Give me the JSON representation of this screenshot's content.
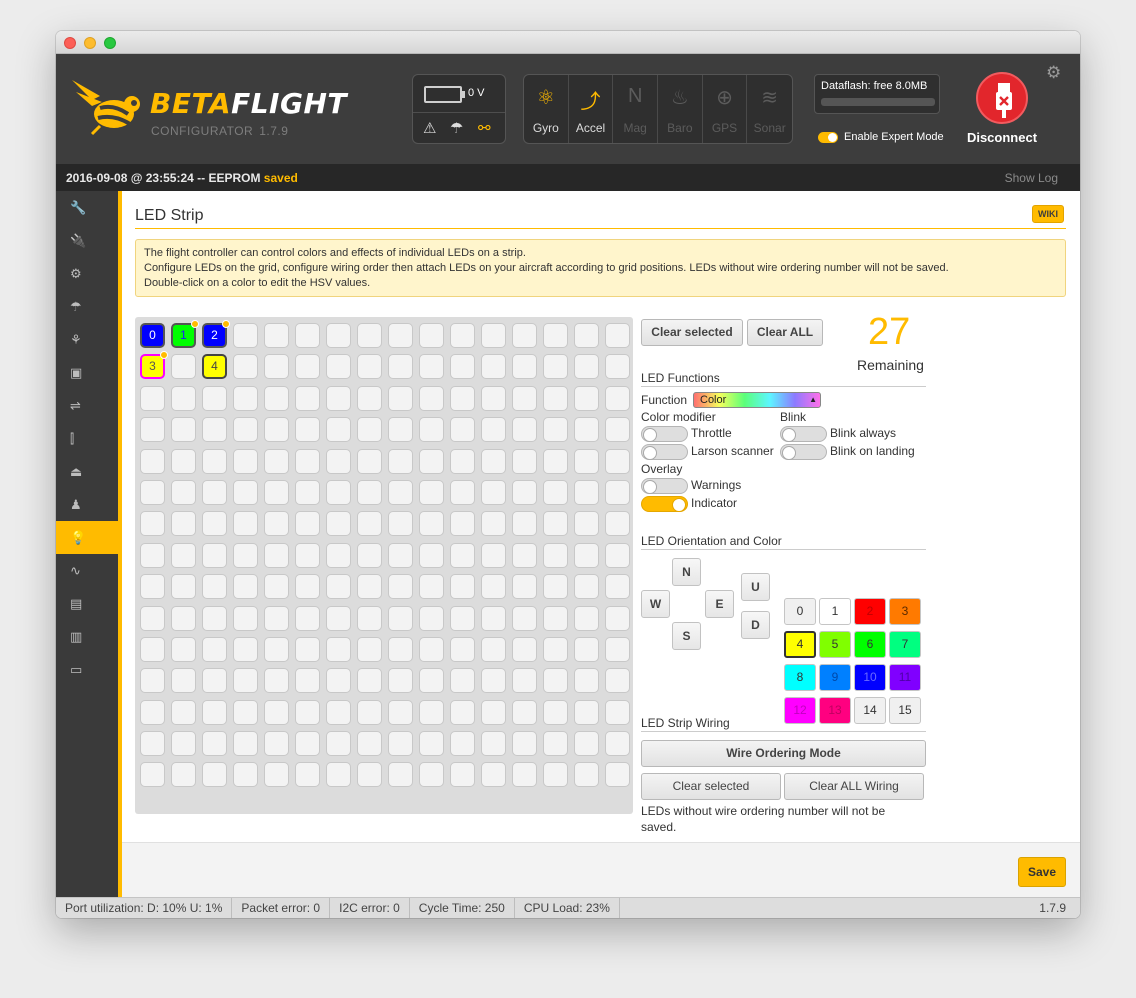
{
  "header": {
    "logo": {
      "title_part1": "BETA",
      "title_part2": "FLIGHT",
      "subtitle": "CONFIGURATOR",
      "version": "1.7.9"
    },
    "battery": {
      "voltage": "0 V"
    },
    "sensors": [
      {
        "label": "Gyro",
        "icon": "gyro-icon",
        "active": true
      },
      {
        "label": "Accel",
        "icon": "accel-icon",
        "active": true
      },
      {
        "label": "Mag",
        "icon": "mag-icon",
        "active": false
      },
      {
        "label": "Baro",
        "icon": "baro-icon",
        "active": false
      },
      {
        "label": "GPS",
        "icon": "gps-icon",
        "active": false
      },
      {
        "label": "Sonar",
        "icon": "sonar-icon",
        "active": false
      }
    ],
    "dataflash": {
      "label": "Dataflash: free 8.0MB"
    },
    "expert_mode": {
      "label": "Enable Expert Mode",
      "enabled": true
    },
    "disconnect": {
      "label": "Disconnect"
    }
  },
  "status": {
    "log_prefix": "2016-09-08 @ 23:55:24 -- EEPROM ",
    "log_saved": "saved",
    "show_log": "Show Log"
  },
  "sidebar": {
    "items": [
      {
        "icon": "wrench-icon",
        "glyph": "🔧"
      },
      {
        "icon": "ports-icon",
        "glyph": "🔌"
      },
      {
        "icon": "gear-icon",
        "glyph": "⚙"
      },
      {
        "icon": "parachute-icon",
        "glyph": "☂"
      },
      {
        "icon": "tree-icon",
        "glyph": "⚘"
      },
      {
        "icon": "receiver-icon",
        "glyph": "▣"
      },
      {
        "icon": "modes-icon",
        "glyph": "⇌"
      },
      {
        "icon": "sliders-icon",
        "glyph": "⫿"
      },
      {
        "icon": "motors-icon",
        "glyph": "⏏"
      },
      {
        "icon": "servos-icon",
        "glyph": "♟"
      },
      {
        "icon": "led-icon",
        "glyph": "💡",
        "active": true
      },
      {
        "icon": "sensors-icon",
        "glyph": "∿"
      },
      {
        "icon": "tethered-icon",
        "glyph": "▤"
      },
      {
        "icon": "blackbox-icon",
        "glyph": "▥"
      },
      {
        "icon": "cli-icon",
        "glyph": "▭"
      }
    ]
  },
  "page": {
    "title": "LED Strip",
    "wiki": "WIKI",
    "note_lines": [
      "The flight controller can control colors and effects of individual LEDs on a strip.",
      "Configure LEDs on the grid, configure wiring order then attach LEDs on your aircraft according to grid positions. LEDs without wire ordering number will not be saved.",
      "Double-click on a color to edit the HSV values."
    ]
  },
  "grid": {
    "cols": 16,
    "rows": 15,
    "leds": [
      {
        "row": 0,
        "col": 0,
        "wire": "0",
        "color": "blue",
        "indicator": false
      },
      {
        "row": 0,
        "col": 1,
        "wire": "1",
        "color": "green",
        "indicator": true
      },
      {
        "row": 0,
        "col": 2,
        "wire": "2",
        "color": "blue",
        "indicator": true
      },
      {
        "row": 1,
        "col": 0,
        "wire": "3",
        "color": "yellow",
        "indicator": true
      },
      {
        "row": 1,
        "col": 2,
        "wire": "4",
        "color": "yellowb",
        "indicator": false
      }
    ]
  },
  "controls": {
    "clear_selected": "Clear selected",
    "clear_all": "Clear ALL",
    "remaining_count": "27",
    "remaining_label": "Remaining",
    "functions_title": "LED Functions",
    "function_label": "Function",
    "function_value": "Color",
    "color_modifier": "Color modifier",
    "blink": "Blink",
    "throttle": "Throttle",
    "larson": "Larson scanner",
    "blink_always": "Blink always",
    "blink_landing": "Blink on landing",
    "overlay": "Overlay",
    "warnings": "Warnings",
    "indicator": "Indicator",
    "orientation_title": "LED Orientation and Color",
    "dirs": {
      "n": "N",
      "w": "W",
      "e": "E",
      "s": "S",
      "u": "U",
      "d": "D"
    },
    "colors": [
      {
        "n": "0",
        "bg": "#f0f0f0",
        "fg": "#333"
      },
      {
        "n": "1",
        "bg": "#ffffff",
        "fg": "#333"
      },
      {
        "n": "2",
        "bg": "#ff0000",
        "fg": "#c00000"
      },
      {
        "n": "3",
        "bg": "#ff7a00",
        "fg": "#5a2a00"
      },
      {
        "n": "4",
        "bg": "#ffff00",
        "fg": "#333",
        "selected": true
      },
      {
        "n": "5",
        "bg": "#80ff00",
        "fg": "#333"
      },
      {
        "n": "6",
        "bg": "#00ff00",
        "fg": "#333"
      },
      {
        "n": "7",
        "bg": "#00ff80",
        "fg": "#333"
      },
      {
        "n": "8",
        "bg": "#00ffff",
        "fg": "#333"
      },
      {
        "n": "9",
        "bg": "#0080ff",
        "fg": "#0048a8"
      },
      {
        "n": "10",
        "bg": "#0000ff",
        "fg": "#6a6aff"
      },
      {
        "n": "11",
        "bg": "#8000ff",
        "fg": "#4d00a6"
      },
      {
        "n": "12",
        "bg": "#ff00ff",
        "fg": "#c000c0"
      },
      {
        "n": "13",
        "bg": "#ff0080",
        "fg": "#c00060"
      },
      {
        "n": "14",
        "bg": "#f0f0f0",
        "fg": "#333"
      },
      {
        "n": "15",
        "bg": "#f0f0f0",
        "fg": "#333"
      }
    ],
    "wiring_title": "LED Strip Wiring",
    "wire_ordering": "Wire Ordering Mode",
    "wiring_clear_selected": "Clear selected",
    "clear_all_wiring": "Clear ALL Wiring",
    "wiring_note": "LEDs without wire ordering number will not be saved."
  },
  "footer": {
    "save": "Save"
  },
  "bottombar": {
    "port": "Port utilization: D: 10% U: 1%",
    "packet": "Packet error: 0",
    "i2c": "I2C error: 0",
    "cycle": "Cycle Time: 250",
    "cpu": "CPU Load: 23%",
    "version": "1.7.9"
  }
}
